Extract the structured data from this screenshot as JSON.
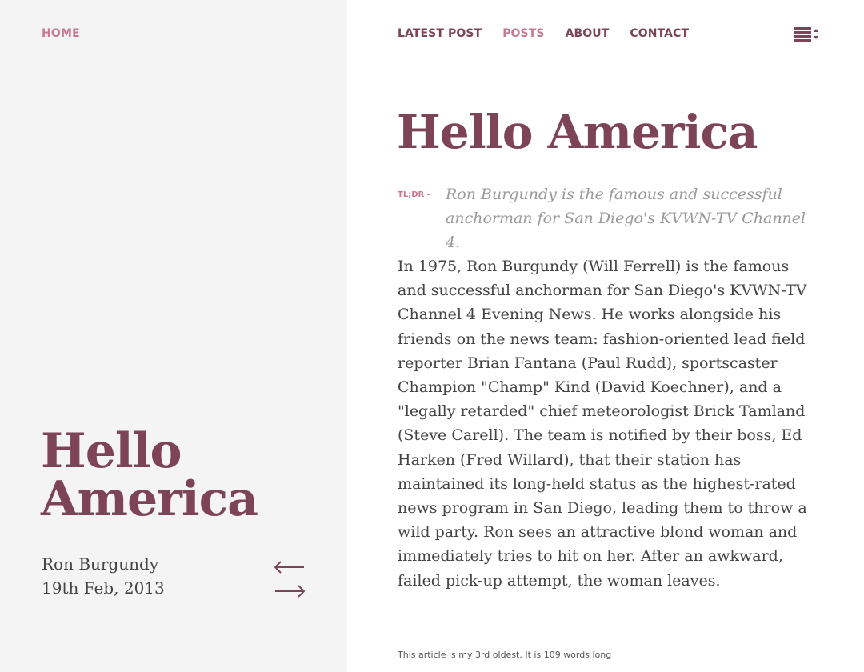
{
  "sidebar": {
    "home_label": "HOME",
    "title": "Hello America",
    "author": "Ron Burgundy",
    "date": "19th Feb, 2013",
    "prev_icon": "arrow-left-icon",
    "next_icon": "arrow-right-icon"
  },
  "nav": {
    "items": [
      {
        "label": "LATEST POST"
      },
      {
        "label": "POSTS"
      },
      {
        "label": "ABOUT"
      },
      {
        "label": "CONTACT"
      }
    ],
    "active": "POSTS",
    "menu_icon": "list-menu-icon"
  },
  "article": {
    "title": "Hello America",
    "tldr_label": "TL;DR -",
    "tldr": "Ron Burgundy is the famous and successful anchorman for San Diego's KVWN-TV Channel 4.",
    "body": "In 1975, Ron Burgundy (Will Ferrell) is the famous and successful anchorman for San Diego's KVWN-TV Channel 4 Evening News. He works alongside his friends on the news team: fashion-oriented lead field reporter Brian Fantana (Paul Rudd), sportscaster Champion \"Champ\" Kind (David Koechner), and a \"legally retarded\" chief meteorologist Brick Tamland (Steve Carell). The team is notified by their boss, Ed Harken (Fred Willard), that their station has maintained its long-held status as the highest-rated news program in San Diego, leading them to throw a wild party. Ron sees an attractive blond woman and immediately tries to hit on her. After an awkward, failed pick-up attempt, the woman leaves.",
    "footnote": "This article is my 3rd oldest. It is 109 words long"
  },
  "colors": {
    "accent": "#7d4357",
    "accent_light": "#c47a92",
    "sidebar_bg": "#f4f4f4",
    "text": "#444444",
    "muted": "#9a9a9a"
  }
}
